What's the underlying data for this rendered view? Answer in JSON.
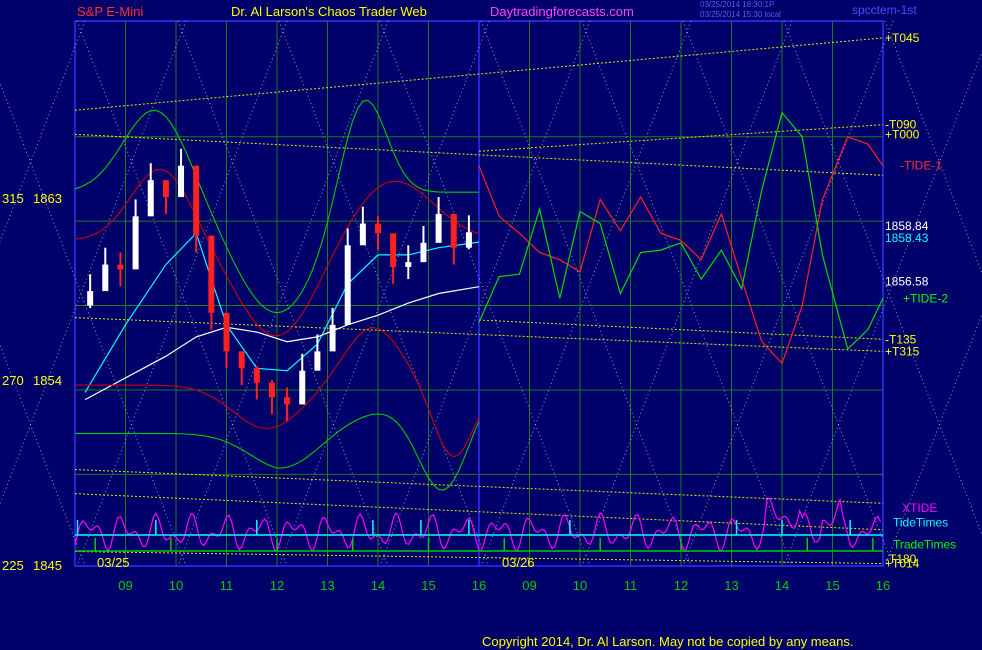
{
  "header": {
    "instrument": "S&P E-Mini",
    "title": "Dr. Al Larson's Chaos Trader Web",
    "site": "Daytradingforecasts.com",
    "timestamp_1": "03/25/2014 18:30:1P",
    "timestamp_2": "03/25/2014 15:30 local",
    "file": "spcctem-1st"
  },
  "footer": {
    "copyright": "Copyright 2014, Dr. Al Larson. May not be copied by any means."
  },
  "colors": {
    "background": "#00006a",
    "frame": "#3030ff",
    "grid": "#1e7a1e",
    "price_up": "#ffffff",
    "price_down": "#ff2020",
    "label_yellow": "#ffff00",
    "green": "#00cc00",
    "red": "#cc0000",
    "magenta": "#ff00ff",
    "cyan": "#00ffff",
    "lavender": "#a0a0ff"
  },
  "chart_data": {
    "type": "line",
    "title": "S&P E-Mini",
    "xlabel": "",
    "ylabel": "",
    "grid": true,
    "ylim": [
      1845,
      1867.6
    ],
    "x_hours_day1": [
      "09",
      "10",
      "11",
      "12",
      "13",
      "14",
      "15",
      "16"
    ],
    "x_hours_day2": [
      "09",
      "10",
      "11",
      "12",
      "13",
      "14",
      "15",
      "16"
    ],
    "date_labels": [
      "03/25",
      "03/26"
    ],
    "y_axis_labels": [
      {
        "angle": "315",
        "price": "1863"
      },
      {
        "angle": "270",
        "price": "1854"
      },
      {
        "angle": "225",
        "price": "1845"
      }
    ],
    "right_labels": [
      {
        "text": "+T045",
        "value": 1866.9,
        "color": "#ffff00"
      },
      {
        "text": "-T090",
        "value": 1863.3,
        "color": "#ffff00"
      },
      {
        "text": "+T000",
        "value": 1862.9,
        "color": "#ffff00"
      },
      {
        "text": "-TIDE-1",
        "value": 1861.6,
        "color": "#ff3030"
      },
      {
        "text": "1858.84",
        "value": 1859.1,
        "color": "#ffffff"
      },
      {
        "text": "1858.43",
        "value": 1858.6,
        "color": "#00ffff"
      },
      {
        "text": "1856.58",
        "value": 1856.8,
        "color": "#ffffff"
      },
      {
        "text": "+TIDE-2",
        "value": 1856.1,
        "color": "#00ff00"
      },
      {
        "text": "-T135",
        "value": 1854.4,
        "color": "#ffff00"
      },
      {
        "text": "+T315",
        "value": 1853.9,
        "color": "#ffff00"
      },
      {
        "text": "XTIDE",
        "value": 1847.4,
        "color": "#ff00ff"
      },
      {
        "text": "TideTimes",
        "value": 1846.8,
        "color": "#00ffff"
      },
      {
        "text": "TradeTimes",
        "value": 1845.9,
        "color": "#00ff00"
      },
      {
        "text": "-T180",
        "value": 1845.3,
        "color": "#ffff00"
      },
      {
        "text": "+T014",
        "value": 1845.1,
        "color": "#ffff00"
      }
    ],
    "series": [
      {
        "name": "Price",
        "kind": "bars",
        "x": [
          8.3,
          8.6,
          8.9,
          9.2,
          9.5,
          9.8,
          10.1,
          10.4,
          10.7,
          11.0,
          11.3,
          11.6,
          11.9,
          12.2,
          12.5,
          12.8,
          13.1,
          13.4,
          13.7,
          14.0,
          14.3,
          14.6,
          14.9,
          15.2,
          15.5,
          15.8
        ],
        "values": [
          1856.4,
          1857.5,
          1857.3,
          1859.5,
          1861.0,
          1860.3,
          1861.6,
          1858.7,
          1855.5,
          1853.9,
          1853.2,
          1852.6,
          1852.0,
          1851.7,
          1853.1,
          1853.9,
          1855.0,
          1858.3,
          1859.2,
          1858.8,
          1857.4,
          1857.6,
          1858.4,
          1859.6,
          1858.2,
          1858.84
        ]
      },
      {
        "name": "Avg short",
        "color": "#00ffff",
        "x": [
          8.2,
          9.0,
          9.8,
          10.4,
          11.0,
          11.6,
          12.2,
          12.8,
          13.4,
          14.0,
          14.6,
          15.2,
          16.0
        ],
        "values": [
          1852.2,
          1855.0,
          1857.5,
          1858.8,
          1855.0,
          1853.2,
          1853.1,
          1854.2,
          1856.7,
          1857.9,
          1857.9,
          1858.2,
          1858.43
        ]
      },
      {
        "name": "Avg long",
        "color": "#ffffff",
        "x": [
          8.2,
          9.0,
          9.8,
          10.4,
          11.0,
          11.6,
          12.2,
          12.8,
          13.4,
          14.0,
          14.6,
          15.2,
          16.0
        ],
        "values": [
          1851.9,
          1852.8,
          1853.7,
          1854.5,
          1854.9,
          1854.7,
          1854.3,
          1854.5,
          1855.0,
          1855.4,
          1855.9,
          1856.3,
          1856.58
        ]
      },
      {
        "name": "-TIDE-1",
        "color": "#ff2020",
        "x": [
          16.0,
          16.4,
          16.8,
          17.2,
          17.6,
          18.0,
          18.4,
          18.8,
          19.2,
          19.6,
          20.0,
          20.4,
          20.8,
          21.2,
          21.6,
          22.0,
          22.4,
          22.8,
          23.3,
          23.7,
          24.0
        ],
        "values": [
          1861.6,
          1859.5,
          1858.8,
          1858.0,
          1857.7,
          1857.2,
          1860.2,
          1858.9,
          1860.3,
          1858.8,
          1858.5,
          1857.7,
          1859.6,
          1856.9,
          1854.3,
          1853.4,
          1855.8,
          1860.2,
          1862.8,
          1862.5,
          1861.6
        ]
      },
      {
        "name": "+TIDE-2",
        "color": "#00dd00",
        "x": [
          16.0,
          16.4,
          16.8,
          17.2,
          17.6,
          18.0,
          18.4,
          18.8,
          19.2,
          19.6,
          20.0,
          20.4,
          20.8,
          21.2,
          21.6,
          22.0,
          22.4,
          22.8,
          23.3,
          23.7,
          24.0
        ],
        "values": [
          1855.1,
          1857.0,
          1857.1,
          1859.8,
          1856.1,
          1859.7,
          1859.2,
          1856.3,
          1858.0,
          1858.1,
          1858.4,
          1856.9,
          1858.1,
          1856.5,
          1860.6,
          1863.8,
          1862.8,
          1857.9,
          1854.0,
          1854.8,
          1856.1
        ]
      }
    ]
  }
}
